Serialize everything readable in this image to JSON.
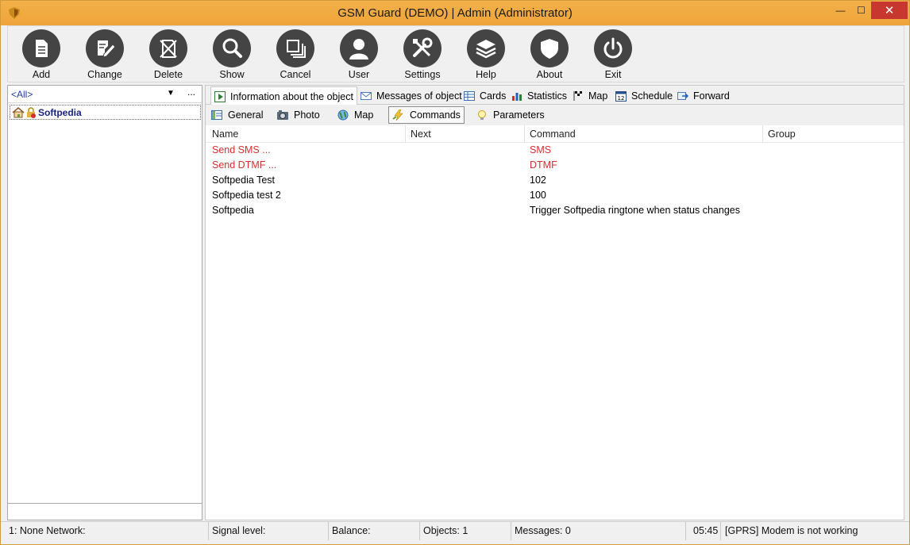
{
  "window": {
    "title": "GSM Guard (DEMO) | Admin (Administrator)",
    "min_glyph": "—",
    "max_glyph": "☐",
    "close_glyph": "✕"
  },
  "toolbar": [
    {
      "label": "Add",
      "icon": "document-icon"
    },
    {
      "label": "Change",
      "icon": "edit-icon"
    },
    {
      "label": "Delete",
      "icon": "delete-icon"
    },
    {
      "label": "Show",
      "icon": "search-icon"
    },
    {
      "label": "Cancel",
      "icon": "cancel-icon"
    },
    {
      "label": "User",
      "icon": "user-icon"
    },
    {
      "label": "Settings",
      "icon": "settings-icon"
    },
    {
      "label": "Help",
      "icon": "help-icon"
    },
    {
      "label": "About",
      "icon": "shield-icon"
    },
    {
      "label": "Exit",
      "icon": "power-icon"
    }
  ],
  "left": {
    "filter": "<All>",
    "filter_arrow": "▼",
    "filter_more": "...",
    "tree_item": "Softpedia"
  },
  "tabs": [
    {
      "label": "Information about the object",
      "active": true
    },
    {
      "label": "Messages of object"
    },
    {
      "label": "Cards"
    },
    {
      "label": "Statistics"
    },
    {
      "label": "Map"
    },
    {
      "label": "Schedule"
    },
    {
      "label": "Forward"
    }
  ],
  "subtabs": [
    {
      "label": "General"
    },
    {
      "label": "Photo"
    },
    {
      "label": "Map"
    },
    {
      "label": "Commands",
      "active": true
    },
    {
      "label": "Parameters"
    }
  ],
  "grid": {
    "columns": [
      "Name",
      "Next",
      "Command",
      "Group"
    ],
    "rows": [
      {
        "name": "Send SMS ...",
        "next": "",
        "command": "SMS",
        "group": "",
        "highlight": true
      },
      {
        "name": "Send DTMF ...",
        "next": "",
        "command": "DTMF",
        "group": "",
        "highlight": true
      },
      {
        "name": "Softpedia Test",
        "next": "",
        "command": "102",
        "group": ""
      },
      {
        "name": "Softpedia test 2",
        "next": "",
        "command": "100",
        "group": ""
      },
      {
        "name": "Softpedia",
        "next": "",
        "command": "Trigger Softpedia ringtone when status changes",
        "group": ""
      }
    ]
  },
  "status": {
    "network": "1: None Network:",
    "signal": "Signal level:",
    "balance": "Balance:",
    "objects": "Objects: 1",
    "messages": "Messages: 0",
    "time": "05:45",
    "modem": "[GPRS] Modem is not working"
  },
  "colors": {
    "titlebar": "#eea43a",
    "highlight_text": "#d32f2f",
    "icon_circle": "#444444"
  }
}
